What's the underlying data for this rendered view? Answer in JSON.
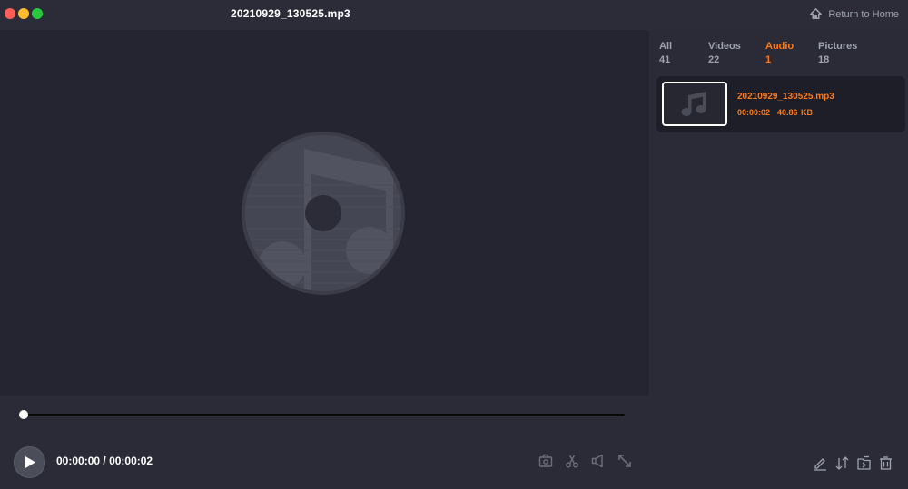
{
  "window": {
    "title": "20210929_130525.mp3",
    "return_home_label": "Return to Home"
  },
  "player": {
    "current_time": "00:00:00",
    "separator": " / ",
    "total_time": "00:00:02",
    "progress": 0.0
  },
  "tabs": [
    {
      "label": "All",
      "count": "41",
      "active": false
    },
    {
      "label": "Videos",
      "count": "22",
      "active": false
    },
    {
      "label": "Audio",
      "count": "1",
      "active": true
    },
    {
      "label": "Pictures",
      "count": "18",
      "active": false
    }
  ],
  "files": [
    {
      "name": "20210929_130525.mp3",
      "duration": "00:00:02",
      "size": "40.86 KB"
    }
  ],
  "icons": {
    "window": [
      "close-icon",
      "minimize-icon",
      "maximize-icon",
      "home-icon"
    ],
    "player": [
      "play-icon",
      "snapshot-icon",
      "cut-icon",
      "volume-icon",
      "fullscreen-icon",
      "music-disc-icon"
    ],
    "side": [
      "edit-icon",
      "sort-icon",
      "export-icon",
      "delete-icon"
    ]
  },
  "colors": {
    "accent": "#ff7a16",
    "background": "#2a2b36",
    "player_background": "#242531"
  }
}
